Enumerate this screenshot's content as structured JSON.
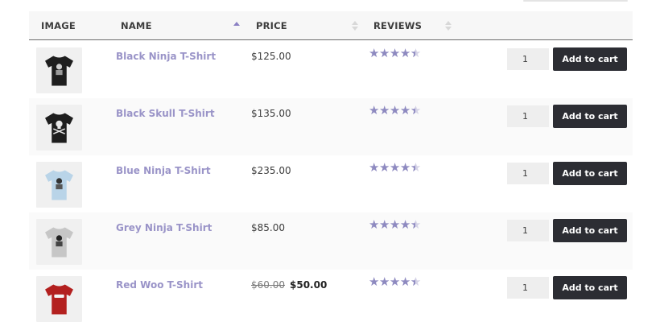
{
  "table": {
    "headers": {
      "image": "IMAGE",
      "name": "NAME",
      "price": "PRICE",
      "reviews": "REVIEWS"
    },
    "sort": {
      "column": "name",
      "direction": "ascending"
    },
    "colors": {
      "link": "#9a94c8",
      "star": "#8e8ac0",
      "button": "#2c2d33",
      "sort_active": "#8b80c4"
    },
    "rows": [
      {
        "name": "Black Ninja T-Shirt",
        "price": "$125.00",
        "old_price": "",
        "rating": 4.5,
        "quantity": "1",
        "button_label": "Add to cart",
        "image_icon": "black-ninja-tshirt-icon",
        "shirt_color": "#1e1e1e"
      },
      {
        "name": "Black Skull T-Shirt",
        "price": "$135.00",
        "old_price": "",
        "rating": 4.5,
        "quantity": "1",
        "button_label": "Add to cart",
        "image_icon": "black-skull-tshirt-icon",
        "shirt_color": "#1e1e1e"
      },
      {
        "name": "Blue Ninja T-Shirt",
        "price": "$235.00",
        "old_price": "",
        "rating": 4.5,
        "quantity": "1",
        "button_label": "Add to cart",
        "image_icon": "blue-ninja-tshirt-icon",
        "shirt_color": "#b9d4e8"
      },
      {
        "name": "Grey Ninja T-Shirt",
        "price": "$85.00",
        "old_price": "",
        "rating": 4.5,
        "quantity": "1",
        "button_label": "Add to cart",
        "image_icon": "grey-ninja-tshirt-icon",
        "shirt_color": "#c6c6c6"
      },
      {
        "name": "Red Woo T-Shirt",
        "price": "$50.00",
        "old_price": "$60.00",
        "rating": 4.5,
        "quantity": "1",
        "button_label": "Add to cart",
        "image_icon": "red-woo-tshirt-icon",
        "shirt_color": "#b3201f"
      }
    ]
  }
}
